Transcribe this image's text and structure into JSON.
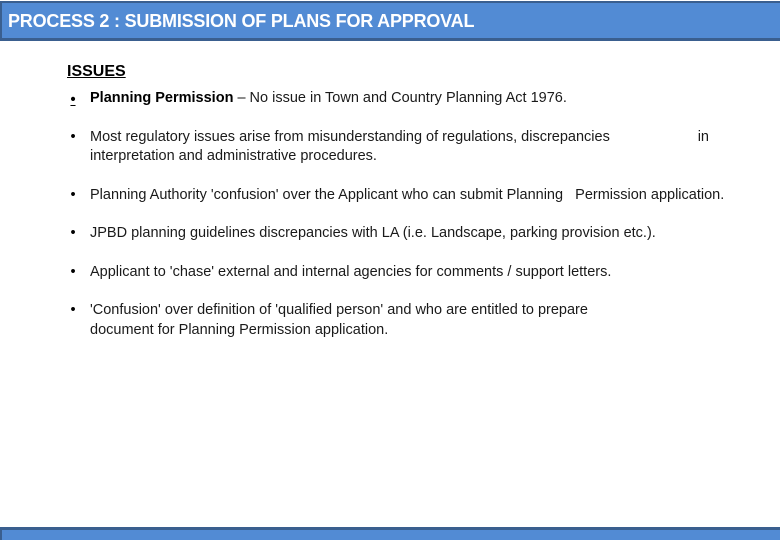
{
  "title": "PROCESS 2 : SUBMISSION OF PLANS FOR APPROVAL",
  "colors": {
    "title_bar": "#528bd4",
    "title_bar_border": "#3a5f8f",
    "title_text": "#ffffff"
  },
  "section": {
    "heading": "ISSUES",
    "bullet_glyph": "•",
    "items": [
      {
        "lead": "Planning Permission",
        "text": " – No issue in Town and Country Planning Act 1976."
      },
      {
        "line1": "Most regulatory issues arise from misunderstanding of regulations, discrepancies",
        "line1_tail": "in",
        "line2": "interpretation and administrative procedures."
      },
      {
        "text": "Planning Authority 'confusion' over the Applicant who can submit Planning   Permission application."
      },
      {
        "text": "JPBD planning guidelines discrepancies with LA (i.e. Landscape, parking provision etc.)."
      },
      {
        "text": "Applicant to 'chase' external and internal agencies for comments / support letters."
      },
      {
        "text": "'Confusion' over definition of 'qualified person' and who are entitled to prepare document for Planning Permission application."
      }
    ]
  }
}
